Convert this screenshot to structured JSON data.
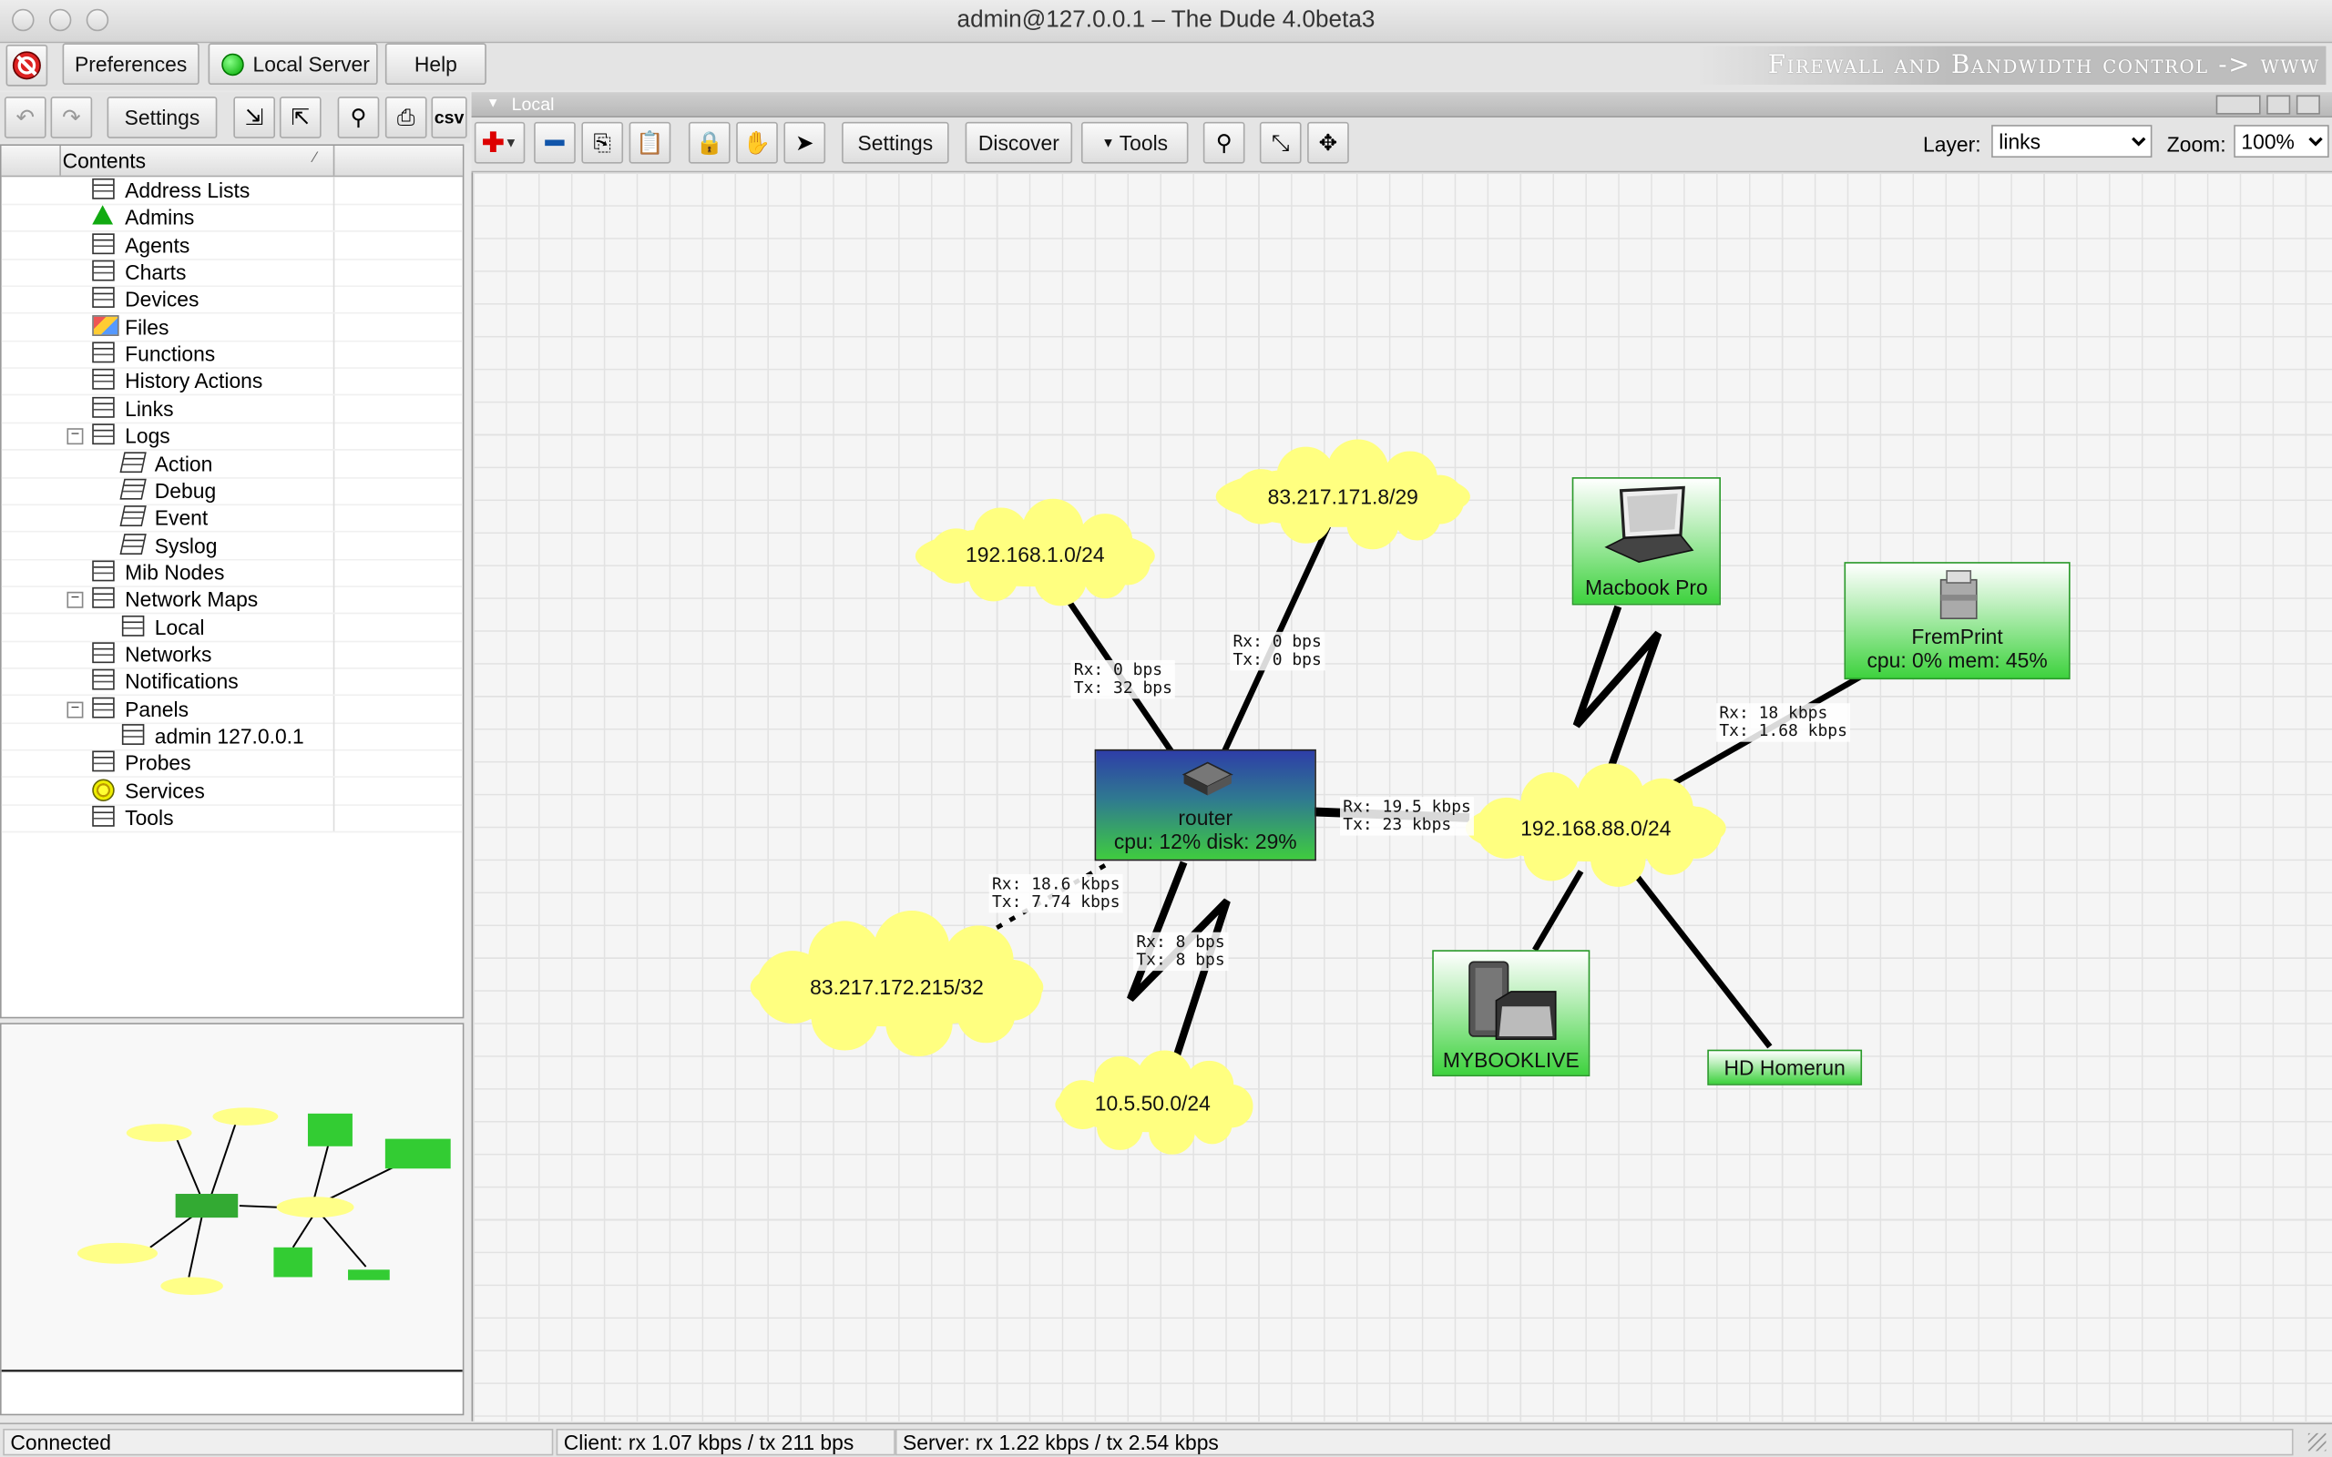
{
  "window": {
    "title": "admin@127.0.0.1 – The Dude 4.0beta3"
  },
  "topbar": {
    "preferences_label": "Preferences",
    "server_label": "Local Server",
    "help_label": "Help",
    "banner": "Firewall and Bandwidth control -> www"
  },
  "left_toolbar": {
    "settings_label": "Settings",
    "csv_label": "csv"
  },
  "contents": {
    "header": "Contents",
    "items": [
      {
        "label": "Address Lists",
        "icon": "table-icon",
        "indent": 0
      },
      {
        "label": "Admins",
        "icon": "admin-icon",
        "indent": 0
      },
      {
        "label": "Agents",
        "icon": "table-icon",
        "indent": 0
      },
      {
        "label": "Charts",
        "icon": "table-icon",
        "indent": 0
      },
      {
        "label": "Devices",
        "icon": "table-icon",
        "indent": 0
      },
      {
        "label": "Files",
        "icon": "files-icon",
        "indent": 0
      },
      {
        "label": "Functions",
        "icon": "table-icon",
        "indent": 0
      },
      {
        "label": "History Actions",
        "icon": "table-icon",
        "indent": 0
      },
      {
        "label": "Links",
        "icon": "table-icon",
        "indent": 0
      },
      {
        "label": "Logs",
        "icon": "table-icon",
        "indent": 0,
        "expanded": true
      },
      {
        "label": "Action",
        "icon": "log-icon",
        "indent": 1
      },
      {
        "label": "Debug",
        "icon": "log-icon",
        "indent": 1
      },
      {
        "label": "Event",
        "icon": "log-icon",
        "indent": 1
      },
      {
        "label": "Syslog",
        "icon": "log-icon",
        "indent": 1
      },
      {
        "label": "Mib Nodes",
        "icon": "table-icon",
        "indent": 0
      },
      {
        "label": "Network Maps",
        "icon": "table-icon",
        "indent": 0,
        "expanded": true
      },
      {
        "label": "Local",
        "icon": "table-icon",
        "indent": 1
      },
      {
        "label": "Networks",
        "icon": "table-icon",
        "indent": 0
      },
      {
        "label": "Notifications",
        "icon": "table-icon",
        "indent": 0
      },
      {
        "label": "Panels",
        "icon": "table-icon",
        "indent": 0,
        "expanded": true
      },
      {
        "label": "admin 127.0.0.1",
        "icon": "table-icon",
        "indent": 1
      },
      {
        "label": "Probes",
        "icon": "table-icon",
        "indent": 0
      },
      {
        "label": "Services",
        "icon": "services-icon",
        "indent": 0
      },
      {
        "label": "Tools",
        "icon": "table-icon",
        "indent": 0
      }
    ]
  },
  "map": {
    "panel_title": "Local",
    "toolbar": {
      "settings_label": "Settings",
      "discover_label": "Discover",
      "tools_label": "Tools",
      "layer_label": "Layer:",
      "layer_value": "links",
      "zoom_label": "Zoom:",
      "zoom_value": "100%"
    },
    "networks": [
      {
        "label": "192.168.1.0/24"
      },
      {
        "label": "83.217.171.8/29"
      },
      {
        "label": "192.168.88.0/24"
      },
      {
        "label": "83.217.172.215/32"
      },
      {
        "label": "10.5.50.0/24"
      }
    ],
    "devices": [
      {
        "name": "router",
        "stats": "cpu: 12% disk: 29%",
        "icon": "router-icon"
      },
      {
        "name": "Macbook Pro",
        "icon": "laptop-icon"
      },
      {
        "name": "FremPrint",
        "stats": "cpu: 0% mem: 45%",
        "icon": "printer-icon"
      },
      {
        "name": "MYBOOKLIVE",
        "icon": "storage-icon"
      },
      {
        "name": "HD Homerun"
      }
    ],
    "link_labels": [
      "Rx: 0 bps\nTx: 32 bps",
      "Rx: 0 bps\nTx: 0 bps",
      "Rx: 18 kbps\nTx: 1.68 kbps",
      "Rx: 19.5 kbps\nTx: 23 kbps",
      "Rx: 18.6 kbps\nTx: 7.74 kbps",
      "Rx: 8 bps\nTx: 8 bps"
    ]
  },
  "status": {
    "connection": "Connected",
    "client": "Client: rx 1.07 kbps / tx 211 bps",
    "server": "Server: rx 1.22 kbps / tx 2.54 kbps"
  }
}
